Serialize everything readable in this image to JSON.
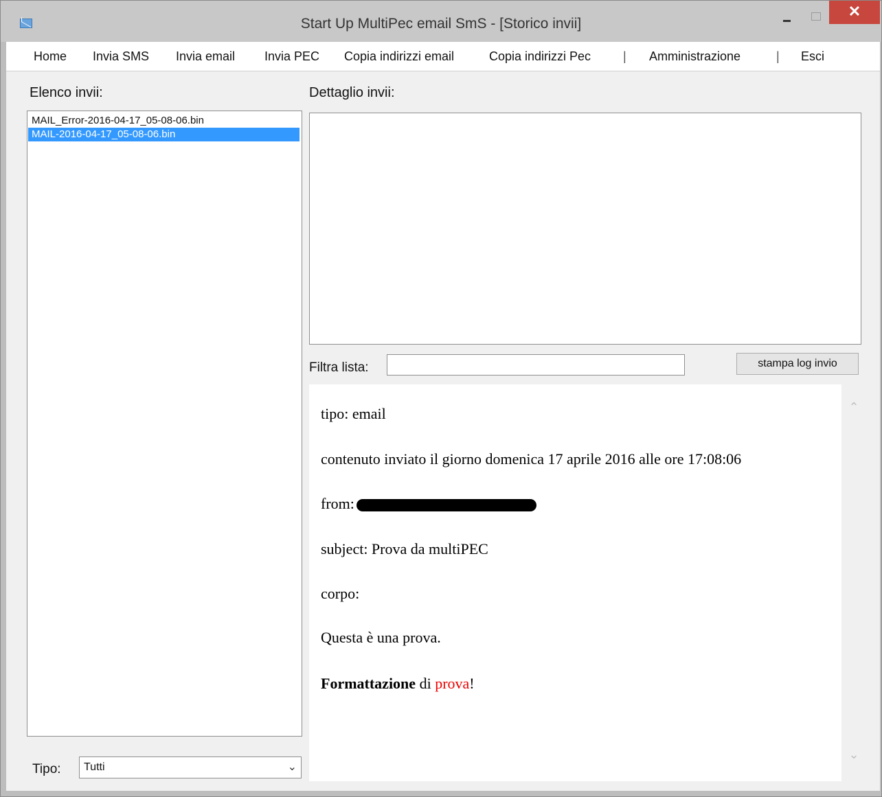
{
  "window": {
    "title": "Start Up MultiPec email SmS - [Storico invii]",
    "close_label": "✕"
  },
  "menu": {
    "items": [
      "Home",
      "Invia SMS",
      "Invia email",
      "Invia PEC",
      "Copia indirizzi email",
      "Copia indirizzi Pec",
      "|",
      "Amministrazione",
      "|",
      "Esci"
    ]
  },
  "left": {
    "label": "Elenco invii:",
    "items": [
      {
        "text": "MAIL_Error-2016-04-17_05-08-06.bin",
        "selected": false
      },
      {
        "text": "MAIL-2016-04-17_05-08-06.bin",
        "selected": true
      }
    ],
    "type_label": "Tipo:",
    "type_value": "Tutti"
  },
  "right": {
    "label": "Dettaglio invii:",
    "filter_label": "Filtra lista:",
    "filter_value": "",
    "print_button": "stampa log invio",
    "log": {
      "type_line": "tipo: email",
      "sent_line": "contenuto inviato il giorno domenica 17 aprile 2016 alle ore 17:08:06",
      "from_label": "from:",
      "subject_line": "subject: Prova da multiPEC",
      "body_label": "corpo:",
      "body_text": "Questa è una prova.",
      "format_bold": "Formattazione",
      "format_mid": " di ",
      "format_red": "prova",
      "format_end": "!"
    }
  },
  "colors": {
    "selection": "#3399ff",
    "close_button": "#c7463d",
    "red_text": "#e00000"
  }
}
